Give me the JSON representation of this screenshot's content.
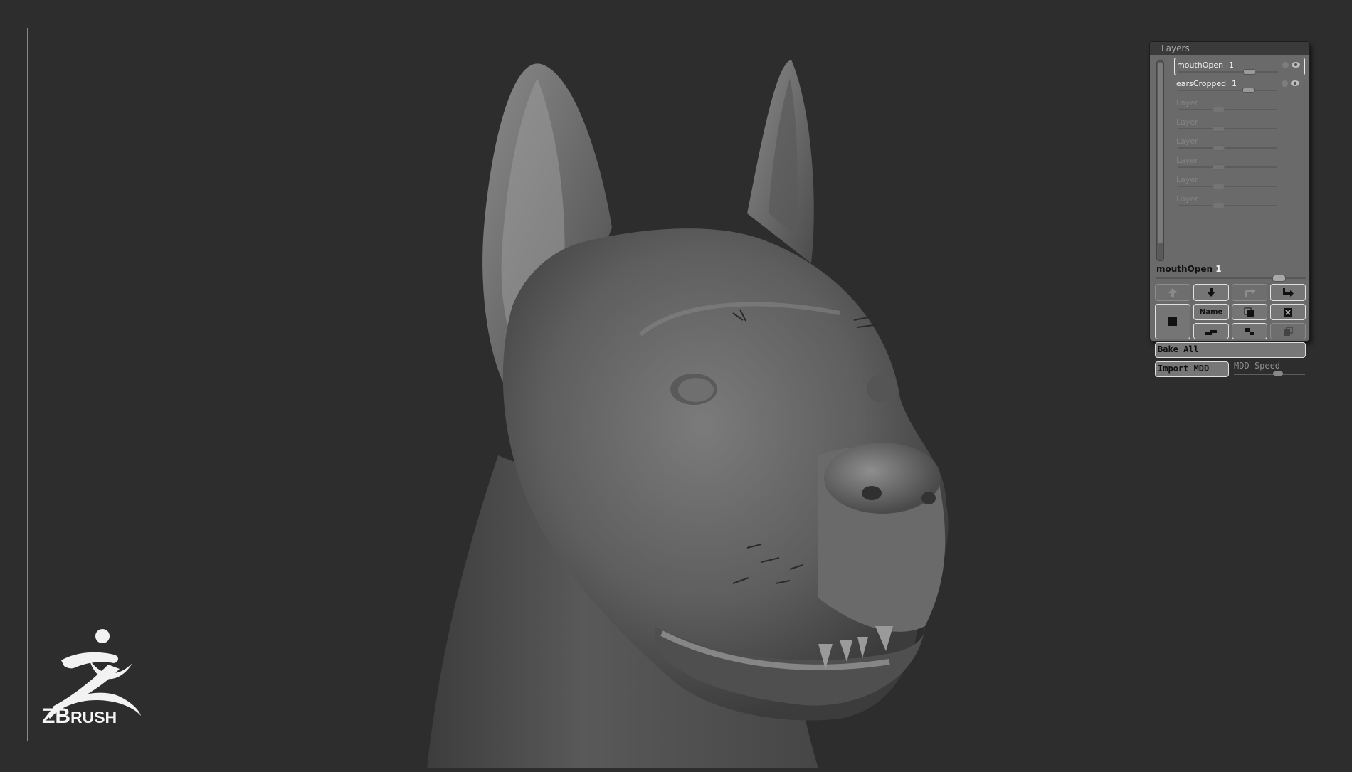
{
  "palette": {
    "title": "Layers",
    "layers": [
      {
        "name": "mouthOpen",
        "num": "1",
        "selected": true,
        "empty": false,
        "level": 0.7
      },
      {
        "name": "earsCropped",
        "num": "1",
        "selected": false,
        "empty": false,
        "level": 0.7
      },
      {
        "name": "Layer",
        "num": "",
        "selected": false,
        "empty": true,
        "level": 0.4
      },
      {
        "name": "Layer",
        "num": "",
        "selected": false,
        "empty": true,
        "level": 0.4
      },
      {
        "name": "Layer",
        "num": "",
        "selected": false,
        "empty": true,
        "level": 0.4
      },
      {
        "name": "Layer",
        "num": "",
        "selected": false,
        "empty": true,
        "level": 0.4
      },
      {
        "name": "Layer",
        "num": "",
        "selected": false,
        "empty": true,
        "level": 0.4
      },
      {
        "name": "Layer",
        "num": "",
        "selected": false,
        "empty": true,
        "level": 0.4
      }
    ],
    "current_layer_name": "mouthOpen",
    "current_layer_num": "1",
    "name_button": "Name",
    "bake_all": "Bake All",
    "import_mdd": "Import MDD",
    "mdd_speed": "MDD Speed"
  },
  "logo": {
    "text_big": "ZB",
    "text_small": "RUSH"
  },
  "colors": {
    "background": "#2d2d2d",
    "frame": "#8a8a8a",
    "palette_bg": "#6a6a6a",
    "sculpt_gray": "#6e6e6e"
  }
}
